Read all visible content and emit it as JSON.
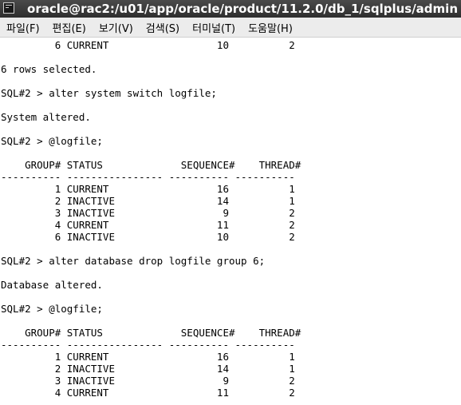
{
  "window": {
    "title": "oracle@rac2:/u01/app/oracle/product/11.2.0/db_1/sqlplus/admin"
  },
  "menu": [
    "파일(F)",
    "편집(E)",
    "보기(V)",
    "검색(S)",
    "터미널(T)",
    "도움말(H)"
  ],
  "terminal": {
    "lines": [
      "         6 CURRENT                  10          2",
      "",
      "6 rows selected.",
      "",
      "SQL#2 > alter system switch logfile;",
      "",
      "System altered.",
      "",
      "SQL#2 > @logfile;",
      "",
      "    GROUP# STATUS             SEQUENCE#    THREAD#",
      "---------- ---------------- ---------- ----------",
      "         1 CURRENT                  16          1",
      "         2 INACTIVE                 14          1",
      "         3 INACTIVE                  9          2",
      "         4 CURRENT                  11          2",
      "         6 INACTIVE                 10          2",
      "",
      "SQL#2 > alter database drop logfile group 6;",
      "",
      "Database altered.",
      "",
      "SQL#2 > @logfile;",
      "",
      "    GROUP# STATUS             SEQUENCE#    THREAD#",
      "---------- ---------------- ---------- ----------",
      "         1 CURRENT                  16          1",
      "         2 INACTIVE                 14          1",
      "         3 INACTIVE                  9          2",
      "         4 CURRENT                  11          2"
    ]
  }
}
